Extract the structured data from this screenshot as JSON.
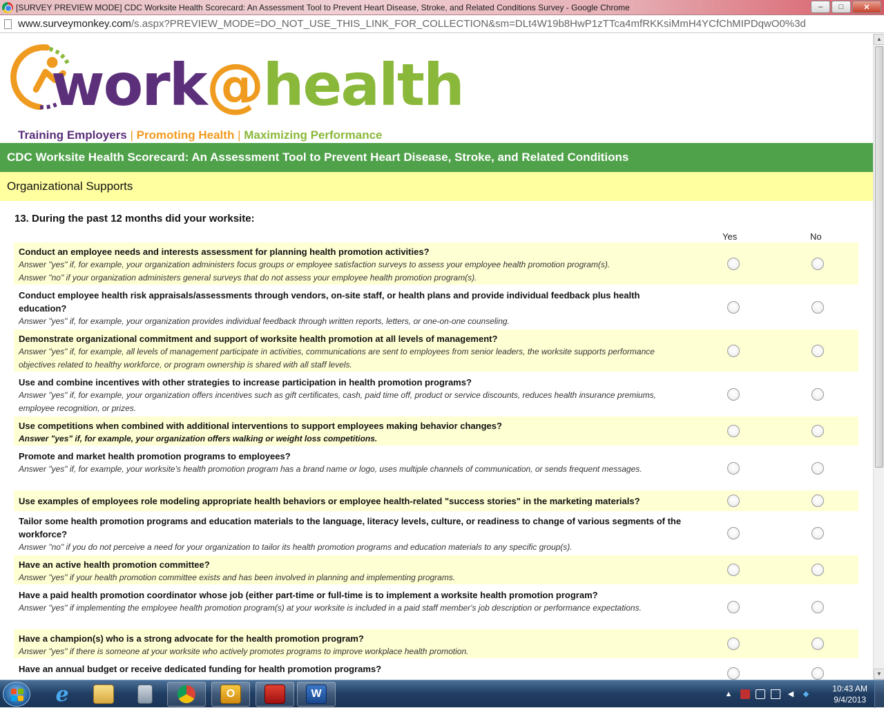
{
  "window": {
    "title": "[SURVEY PREVIEW MODE] CDC Worksite Health Scorecard: An Assessment Tool to Prevent Heart Disease, Stroke, and Related Conditions Survey - Google Chrome",
    "minimize": "–",
    "maximize": "□",
    "close": "✕"
  },
  "address": {
    "host": "www.surveymonkey.com",
    "path": "/s.aspx?PREVIEW_MODE=DO_NOT_USE_THIS_LINK_FOR_COLLECTION&sm=DLt4W19b8HwP1zTTca4mfRKKsiMmH4YCfChMIPDqwO0%3d"
  },
  "logo": {
    "word1": "work",
    "at": "@",
    "word2": "health",
    "tag1": "Training Employers",
    "tag2": "Promoting Health",
    "tag3": "Maximizing Performance",
    "separator": "|",
    "colors": {
      "purple": "#5b2f7a",
      "orange": "#ef9b1f",
      "green": "#8ab83a"
    }
  },
  "survey": {
    "title": "CDC Worksite Health Scorecard: An Assessment Tool to Prevent Heart Disease, Stroke, and Related Conditions",
    "page_title": "Organizational Supports",
    "question": "13. During the past 12 months did your worksite:",
    "col_yes": "Yes",
    "col_no": "No",
    "rows": [
      {
        "main": "Conduct an employee needs and interests assessment for planning health promotion activities?",
        "note": "Answer \"yes\" if, for example, your organization administers focus groups or employee satisfaction surveys to assess your employee health promotion program(s).",
        "note2": "Answer \"no\" if your organization administers general surveys that do not assess your employee health promotion program(s)."
      },
      {
        "main": "Conduct employee health risk appraisals/assessments through vendors, on-site staff, or health plans and provide individual feedback plus health education?",
        "note": "Answer \"yes\" if, for example, your organization provides individual feedback through written reports, letters, or one-on-one counseling."
      },
      {
        "main": "Demonstrate organizational commitment and support of worksite health promotion at all levels of management?",
        "note": "Answer \"yes\" if, for example, all levels of management participate in activities, communications are sent to employees from senior leaders, the worksite supports performance objectives related to healthy workforce, or program ownership is shared with all staff levels."
      },
      {
        "main": "Use and combine incentives with other strategies to increase participation in health promotion programs?",
        "note": "Answer \"yes\" if, for example, your organization offers incentives such as gift certificates, cash, paid time off, product or service discounts, reduces health insurance premiums, employee recognition, or prizes."
      },
      {
        "main": "Use competitions when combined with additional interventions to support employees making behavior changes?",
        "note": "Answer \"yes\" if, for example, your organization offers walking or weight loss competitions."
      },
      {
        "main": "Promote and market health promotion programs to employees?",
        "note": "Answer \"yes\" if, for example, your worksite's health promotion program has a brand name or logo, uses multiple channels of communication, or sends frequent messages."
      },
      {
        "main": "Use examples of employees role modeling appropriate health behaviors or employee health-related \"success stories\" in the marketing materials?"
      },
      {
        "main": "Tailor some health promotion programs and education materials to the language, literacy levels, culture, or readiness to change of various segments of the workforce?",
        "note": "Answer \"no\" if you do not perceive a need for your organization to tailor its health promotion programs and education materials to any specific group(s)."
      },
      {
        "main": "Have an active health promotion committee?",
        "note": "Answer \"yes\" if your health promotion committee exists and has been involved in planning and implementing programs."
      },
      {
        "main": "Have a paid health promotion coordinator whose job (either part-time or full-time is to implement a worksite health promotion program?",
        "note": "Answer \"yes\" if implementing the employee health promotion program(s) at your worksite is included in a paid staff member's job description or performance expectations."
      },
      {
        "main": "Have a champion(s) who is a strong advocate for the health promotion program?",
        "note": "Answer \"yes\" if there is someone at your worksite who actively promotes programs to improve workplace health promotion."
      },
      {
        "main": "Have an annual budget or receive dedicated funding for health promotion programs?"
      }
    ]
  },
  "taskbar": {
    "apps": [
      "start",
      "internet-explorer",
      "file-explorer",
      "calculator",
      "chrome",
      "outlook",
      "acrobat",
      "word"
    ],
    "clock_time": "10:43 AM",
    "clock_date": "9/4/2013",
    "word_letter": "W",
    "outlook_letter": "O",
    "ie_letter": "e"
  }
}
